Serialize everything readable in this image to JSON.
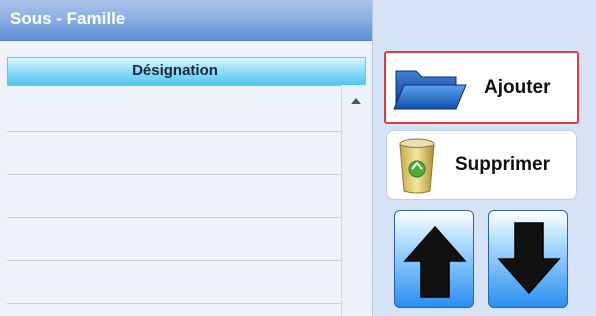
{
  "panel": {
    "title": "Sous - Famille",
    "column_header": "Désignation",
    "rows": [
      "",
      "",
      "",
      "",
      ""
    ]
  },
  "actions": {
    "add_label": "Ajouter",
    "delete_label": "Supprimer"
  },
  "colors": {
    "title_bar": "#8db0e3",
    "header": "#52c6ef",
    "add_border": "#e03b3b",
    "arrow_fill": "#2a8ef0"
  },
  "icons": {
    "add": "folder-icon",
    "delete": "recycle-bin-icon",
    "up": "arrow-up-icon",
    "down": "arrow-down-icon"
  }
}
